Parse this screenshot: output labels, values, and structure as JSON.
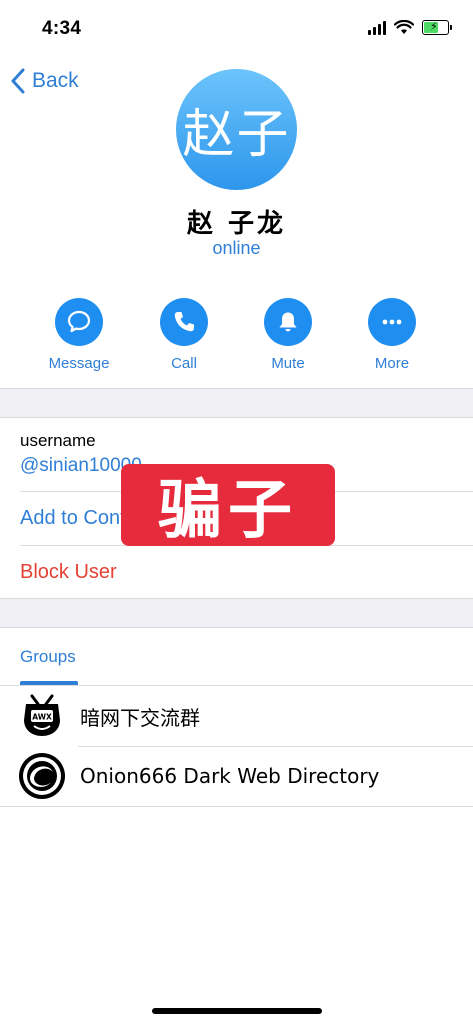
{
  "status_bar": {
    "time": "4:34"
  },
  "nav": {
    "back_label": "Back"
  },
  "profile": {
    "avatar_text": "赵子",
    "name": "赵 子龙",
    "presence": "online",
    "accent_color": "#2f7fd6"
  },
  "actions": [
    {
      "label": "Message",
      "icon": "chat-bubble-icon"
    },
    {
      "label": "Call",
      "icon": "phone-icon"
    },
    {
      "label": "Mute",
      "icon": "bell-icon"
    },
    {
      "label": "More",
      "icon": "more-dots-icon"
    }
  ],
  "info": {
    "username_caption": "username",
    "username_value": "@sinian10000",
    "add_contact": "Add to Contacts",
    "block_user": "Block User"
  },
  "overlay": {
    "badge_text": "骗子",
    "badge_color": "#e52b3c"
  },
  "groups": {
    "tab_label": "Groups",
    "items": [
      {
        "name": "暗网下交流群",
        "icon": "awx-tv-icon",
        "icon_text": "AWX"
      },
      {
        "name": "Onion666 Dark Web Directory",
        "icon": "onion-circle-icon"
      }
    ]
  }
}
